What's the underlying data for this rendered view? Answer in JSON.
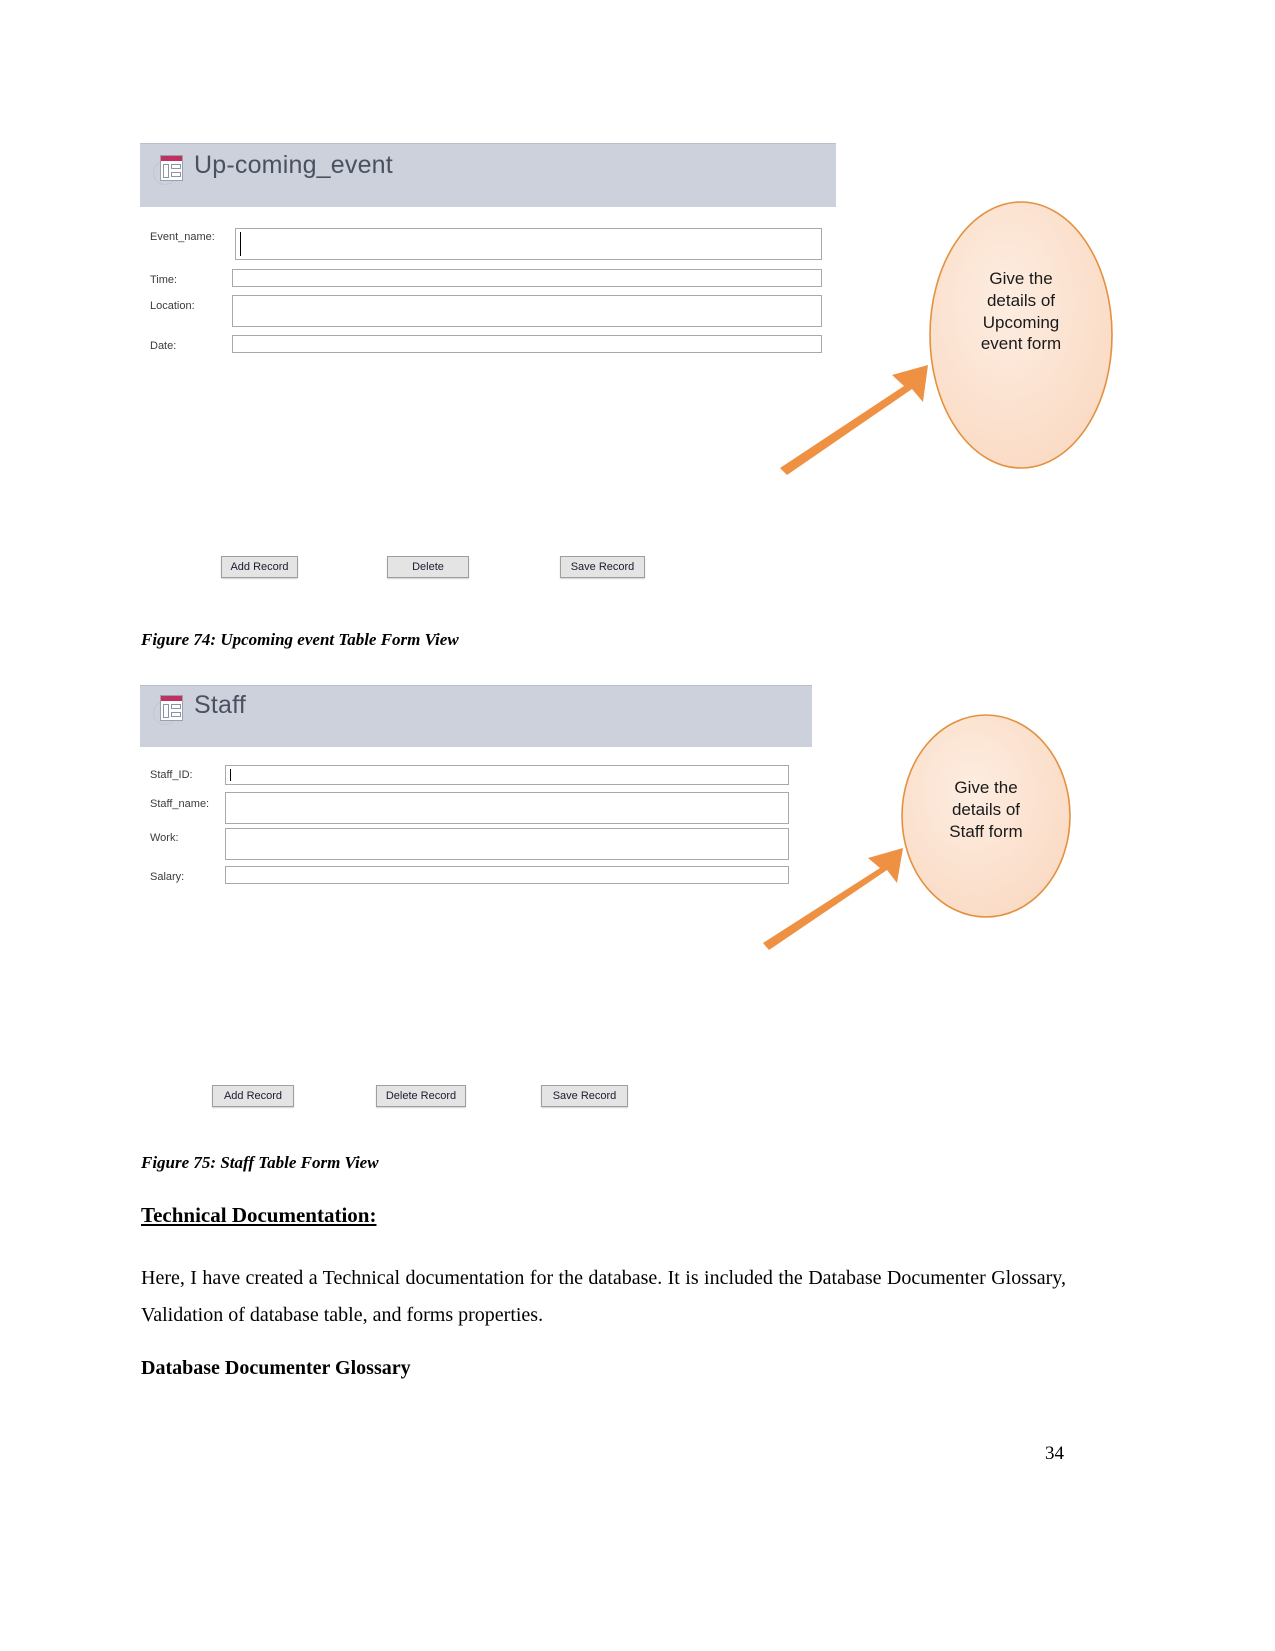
{
  "page": {
    "number": "34"
  },
  "form1": {
    "title": "Up-coming_event",
    "icon": "form-table-icon",
    "fields": [
      {
        "label": "Event_name:",
        "value": "",
        "focused": true
      },
      {
        "label": "Time:",
        "value": "",
        "focused": false
      },
      {
        "label": "Location:",
        "value": "",
        "focused": false
      },
      {
        "label": "Date:",
        "value": "",
        "focused": false
      }
    ],
    "buttons": [
      {
        "label": "Add Record"
      },
      {
        "label": "Delete"
      },
      {
        "label": "Save Record"
      }
    ],
    "callout": {
      "lines": [
        "Give the",
        "details of",
        "Upcoming",
        "event form"
      ],
      "fill": "#FBE1CD",
      "stroke": "#E3913F"
    },
    "caption": "Figure 74: Upcoming event Table Form View"
  },
  "form2": {
    "title": "Staff",
    "icon": "form-table-icon",
    "fields": [
      {
        "label": "Staff_ID:",
        "value": "",
        "focused": true
      },
      {
        "label": "Staff_name:",
        "value": "",
        "focused": false
      },
      {
        "label": "Work:",
        "value": "",
        "focused": false
      },
      {
        "label": "Salary:",
        "value": "",
        "focused": false
      }
    ],
    "buttons": [
      {
        "label": "Add Record"
      },
      {
        "label": "Delete Record"
      },
      {
        "label": "Save Record"
      }
    ],
    "callout": {
      "lines": [
        "Give the",
        "details of",
        "Staff form"
      ],
      "fill": "#FBE1CD",
      "stroke": "#E3913F"
    },
    "caption": "Figure 75: Staff Table Form View"
  },
  "content": {
    "technical_heading": "Technical Documentation:",
    "paragraph": "Here, I have created a Technical documentation for the database. It is included the Database Documenter Glossary, Validation of database table, and forms properties.",
    "glossary_heading": "Database Documenter Glossary"
  },
  "colors": {
    "header_bg": "#CCD1DC",
    "arrow": "#EE9143",
    "callout_fill": "#FBE1CD",
    "callout_stroke": "#E3913F",
    "button_bg": "#E4E4E4"
  }
}
